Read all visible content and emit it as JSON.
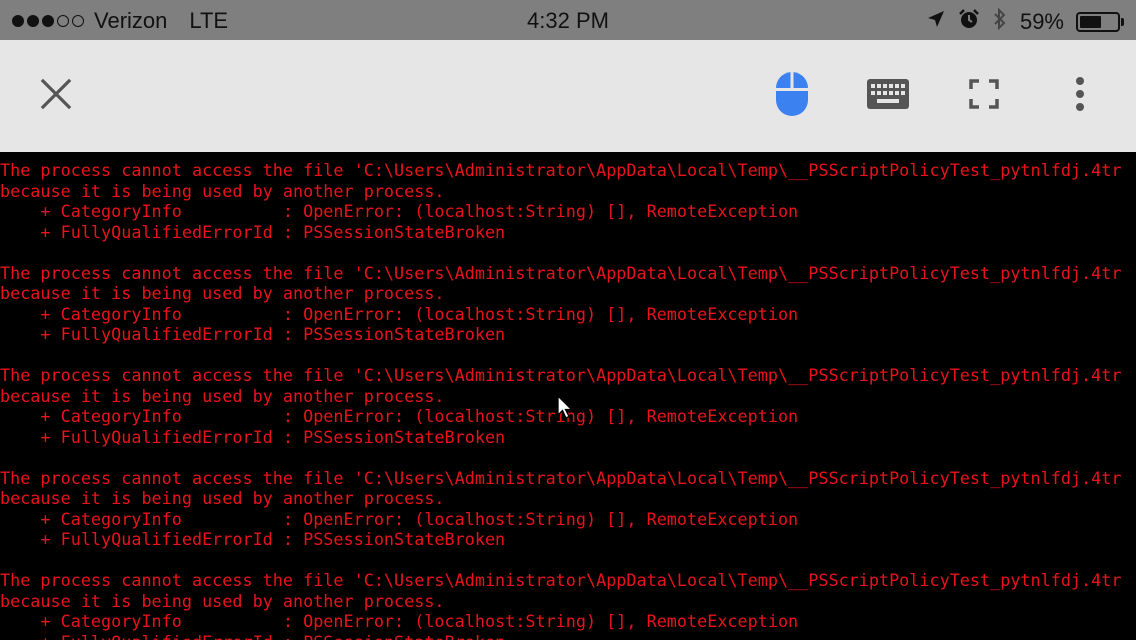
{
  "status_bar": {
    "carrier": "Verizon",
    "network": "LTE",
    "time": "4:32 PM",
    "battery_percent": "59%",
    "battery_level": 0.59,
    "signal_bars_filled": 3,
    "signal_bars_total": 5,
    "icons": [
      "location-arrow-icon",
      "alarm-clock-icon",
      "bluetooth-icon",
      "battery-icon"
    ]
  },
  "toolbar": {
    "icons": [
      "close-icon",
      "mouse-icon",
      "keyboard-icon",
      "fullscreen-icon",
      "more-vert-icon"
    ],
    "accent": "#3b82f0",
    "icon_color": "#555555",
    "background": "#e6e6e6"
  },
  "terminal": {
    "text_color": "#e8141a",
    "background": "#000000",
    "lines": [
      "The process cannot access the file 'C:\\Users\\Administrator\\AppData\\Local\\Temp\\__PSScriptPolicyTest_pytnlfdj.4tr",
      "because it is being used by another process.",
      "    + CategoryInfo          : OpenError: (localhost:String) [], RemoteException",
      "    + FullyQualifiedErrorId : PSSessionStateBroken",
      "",
      "The process cannot access the file 'C:\\Users\\Administrator\\AppData\\Local\\Temp\\__PSScriptPolicyTest_pytnlfdj.4tr",
      "because it is being used by another process.",
      "    + CategoryInfo          : OpenError: (localhost:String) [], RemoteException",
      "    + FullyQualifiedErrorId : PSSessionStateBroken",
      "",
      "The process cannot access the file 'C:\\Users\\Administrator\\AppData\\Local\\Temp\\__PSScriptPolicyTest_pytnlfdj.4tr",
      "because it is being used by another process.",
      "    + CategoryInfo          : OpenError: (localhost:String) [], RemoteException",
      "    + FullyQualifiedErrorId : PSSessionStateBroken",
      "",
      "The process cannot access the file 'C:\\Users\\Administrator\\AppData\\Local\\Temp\\__PSScriptPolicyTest_pytnlfdj.4tr",
      "because it is being used by another process.",
      "    + CategoryInfo          : OpenError: (localhost:String) [], RemoteException",
      "    + FullyQualifiedErrorId : PSSessionStateBroken",
      "",
      "The process cannot access the file 'C:\\Users\\Administrator\\AppData\\Local\\Temp\\__PSScriptPolicyTest_pytnlfdj.4tr",
      "because it is being used by another process.",
      "    + CategoryInfo          : OpenError: (localhost:String) [], RemoteException",
      "    + FullyQualifiedErrorId : PSSessionStateBroken"
    ]
  },
  "pointer": {
    "icon": "mouse-pointer-icon"
  }
}
